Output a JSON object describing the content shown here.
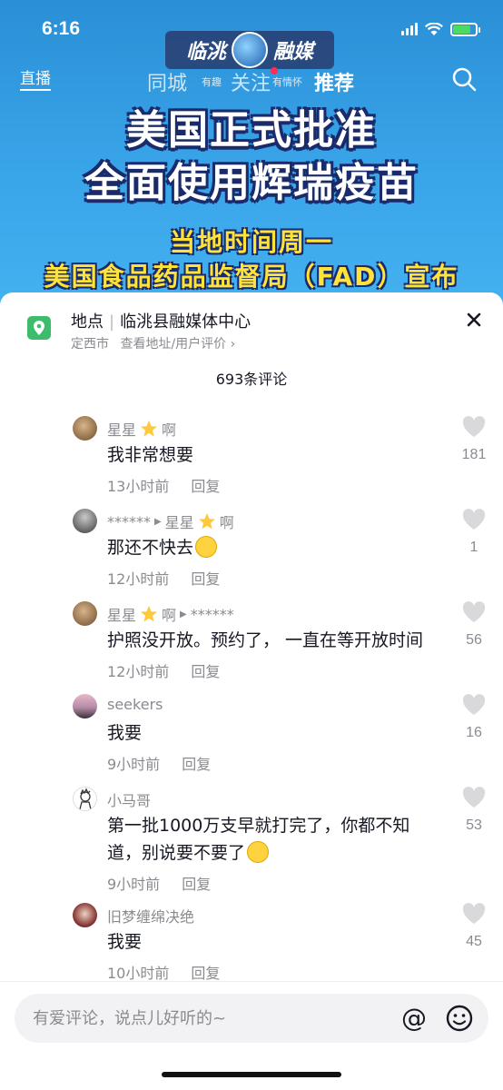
{
  "status": {
    "time": "6:16"
  },
  "video": {
    "logo_text_left": "临洮",
    "logo_text_right": "融媒",
    "nav": {
      "live": "直播",
      "tabs": [
        "同城",
        "关注",
        "推荐"
      ],
      "small_left": "有趣",
      "small_right": "有情怀"
    },
    "headline_1": "美国正式批准",
    "headline_2": "全面使用辉瑞疫苗",
    "subline_1": "当地时间周一",
    "subline_2": "美国食品药品监督局（FAD）宣布"
  },
  "location": {
    "label": "地点",
    "name": "临洮县融媒体中心",
    "city": "定西市",
    "action": "查看地址/用户评价"
  },
  "comments_header": "693条评论",
  "comments": [
    {
      "user": "星星",
      "suffix": "啊",
      "reply_to": "",
      "text": "我非常想要",
      "time": "13小时前",
      "reply": "回复",
      "likes": "181"
    },
    {
      "user": "******",
      "suffix": "",
      "reply_to": "星星",
      "reply_to_suffix": "啊",
      "text": "那还不快去",
      "time": "12小时前",
      "reply": "回复",
      "likes": "1"
    },
    {
      "user": "星星",
      "suffix": "啊",
      "reply_to": "******",
      "text": "护照没开放。预约了， 一直在等开放时间",
      "time": "12小时前",
      "reply": "回复",
      "likes": "56"
    },
    {
      "user": "seekers",
      "suffix": "",
      "reply_to": "",
      "text": "我要",
      "time": "9小时前",
      "reply": "回复",
      "likes": "16"
    },
    {
      "user": "小马哥",
      "suffix": "",
      "reply_to": "",
      "text_line1": "第一批1000万支早就打完了，你都不知",
      "text_line2": "道，别说要不要了",
      "time": "9小时前",
      "reply": "回复",
      "likes": "53"
    },
    {
      "user": "旧梦缠绵决绝",
      "suffix": "",
      "reply_to": "",
      "text": "我要",
      "time": "10小时前",
      "reply": "回复",
      "likes": "45"
    }
  ],
  "input": {
    "placeholder": "有爱评论，说点儿好听的~",
    "at_symbol": "@"
  },
  "colors": {
    "accent_green": "#3dbd6b",
    "text_primary": "#161823",
    "text_secondary": "#8a8b91"
  }
}
